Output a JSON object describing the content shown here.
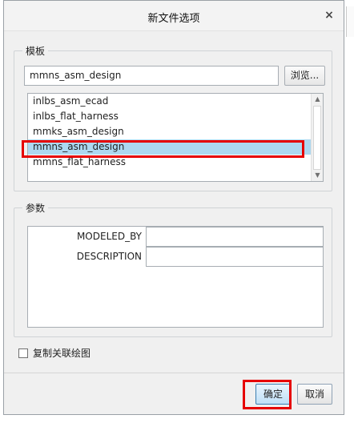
{
  "dialog": {
    "title": "新文件选项",
    "close_glyph": "×"
  },
  "template_group": {
    "label": "模板",
    "input_value": "mmns_asm_design",
    "browse_label": "浏览...",
    "items": [
      {
        "label": "inlbs_asm_ecad",
        "selected": false
      },
      {
        "label": "inlbs_flat_harness",
        "selected": false
      },
      {
        "label": "mmks_asm_design",
        "selected": false
      },
      {
        "label": "mmns_asm_design",
        "selected": true
      },
      {
        "label": "mmns_flat_harness",
        "selected": false
      }
    ]
  },
  "params_group": {
    "label": "参数",
    "rows": [
      {
        "name": "MODELED_BY",
        "value": ""
      },
      {
        "name": "DESCRIPTION",
        "value": ""
      }
    ]
  },
  "copy_drawing": {
    "label": "复制关联绘图",
    "checked": false
  },
  "buttons": {
    "ok_label": "确定",
    "cancel_label": "取消"
  },
  "colors": {
    "selection": "#add8f0",
    "annotation_red": "#e60000"
  },
  "icons": {
    "close": "close-icon",
    "scroll_up": "chevron-up-icon",
    "scroll_down": "chevron-down-icon"
  }
}
